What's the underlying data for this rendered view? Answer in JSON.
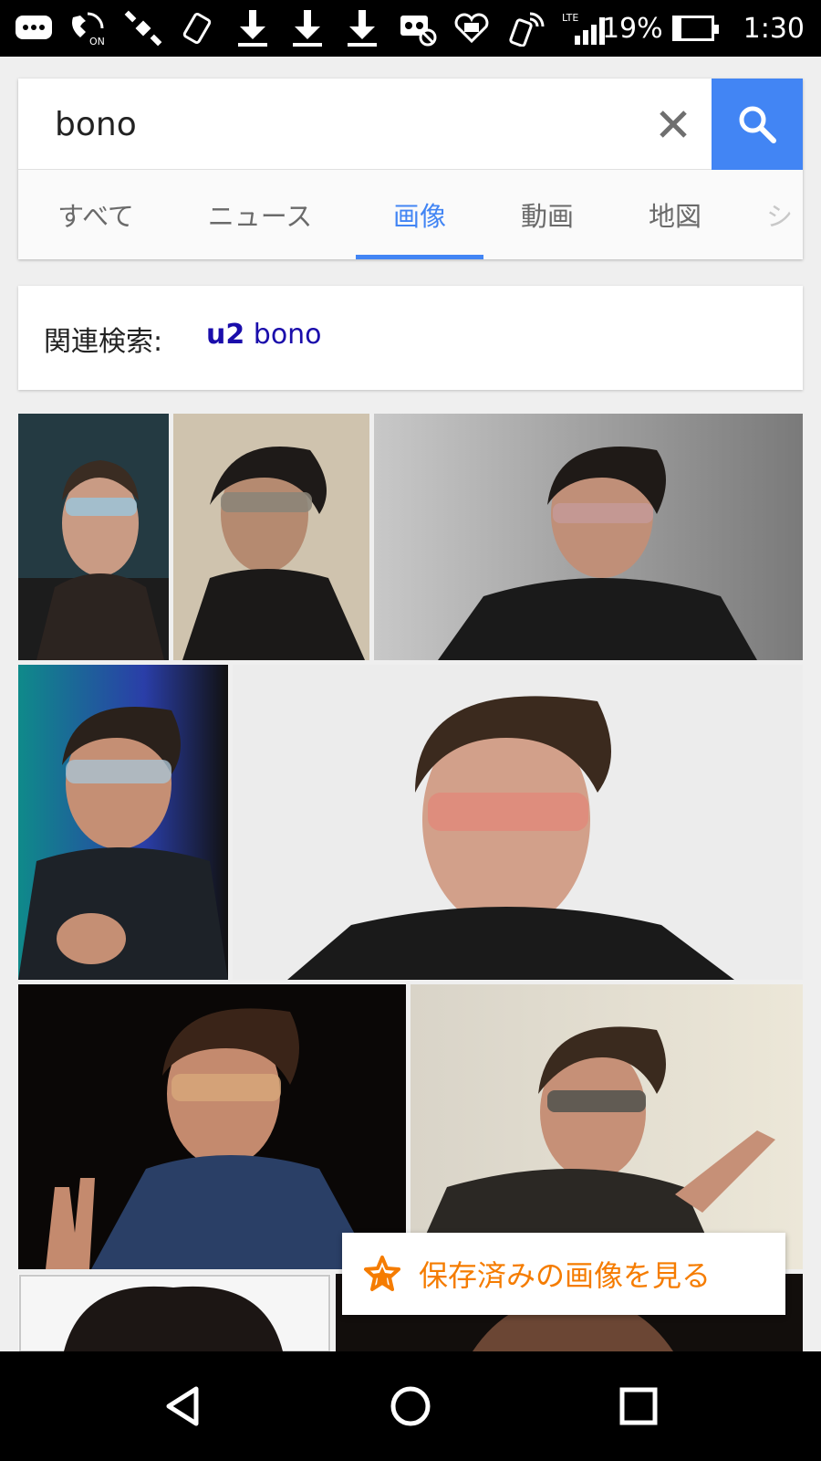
{
  "status_bar": {
    "icons": [
      "message-icon",
      "wifi-calling-on-icon",
      "satellite-icon",
      "screen-rotate-icon",
      "download-icon",
      "download-icon",
      "download-icon",
      "voicemail-blocked-icon",
      "heart-message-icon",
      "nfc-phone-icon",
      "lte-signal-icon"
    ],
    "lte_label": "LTE",
    "battery_percent": "19%",
    "battery_level": 0.19,
    "time": "1:30"
  },
  "search": {
    "query": "bono",
    "clear_icon": "close-icon",
    "search_icon": "search-icon",
    "accent": "#4285f4"
  },
  "tabs": [
    {
      "label": "すべて"
    },
    {
      "label": "ニュース"
    },
    {
      "label": "画像",
      "active": true
    },
    {
      "label": "動画"
    },
    {
      "label": "地図"
    },
    {
      "label": "シ"
    }
  ],
  "related": {
    "label": "関連検索:",
    "bold": "u2",
    "rest": " bono",
    "link_color": "#1a0dab"
  },
  "results": {
    "image_count": 9
  },
  "saved_images": {
    "label": "保存済みの画像を見る",
    "icon": "star-icon",
    "color": "#f57c00"
  },
  "nav": {
    "back_icon": "back-icon",
    "home_icon": "home-icon",
    "recents_icon": "recents-icon"
  }
}
